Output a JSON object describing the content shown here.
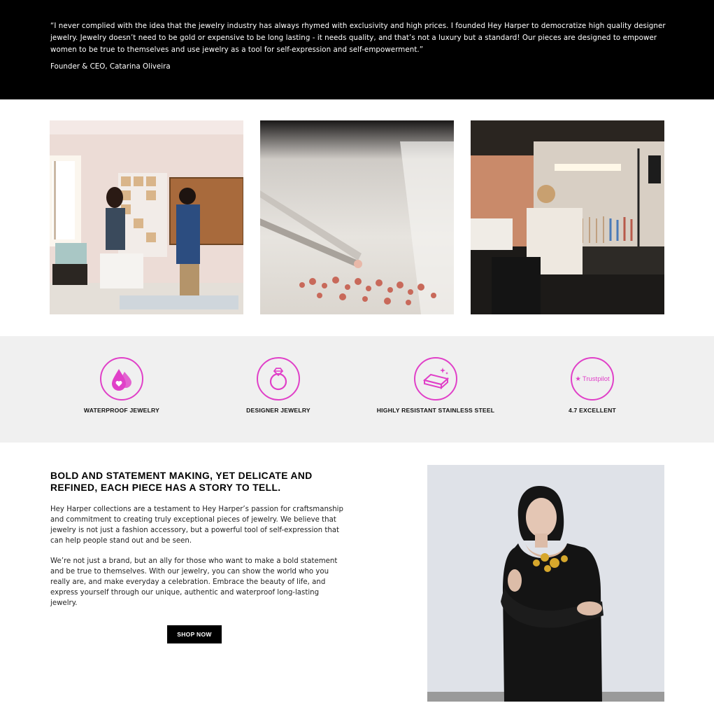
{
  "quote": {
    "text": "“I never complied with the idea that the jewelry industry has always rhymed with exclusivity and high prices. I founded Hey Harper to democratize high quality designer jewelry. Jewelry doesn’t need to be gold or expensive to be long lasting - it needs quality, and that’s not a luxury but a standard! Our pieces are designed to empower women to be true to themselves and use jewelry as a tool for self-expression and self-empowerment.”",
    "author": "Founder & CEO, Catarina Oliveira"
  },
  "features": [
    {
      "label": "WATERPROOF JEWELRY",
      "icon": "waterproof-drop-icon"
    },
    {
      "label": "DESIGNER JEWELRY",
      "icon": "ring-icon"
    },
    {
      "label": "HIGHLY RESISTANT STAINLESS STEEL",
      "icon": "steel-bar-icon"
    },
    {
      "label": "4.7 EXCELLENT",
      "icon": "trustpilot-icon",
      "badge": "Trustpilot"
    }
  ],
  "story": {
    "title": "BOLD AND STATEMENT MAKING, YET DELICATE AND REFINED, EACH PIECE HAS A STORY TO TELL.",
    "paragraph1": "Hey Harper collections are a testament to Hey Harper’s passion for craftsmanship and commitment to creating truly exceptional pieces of jewelry. We believe that jewelry is not just a fashion accessory, but a powerful tool of self-expression that can help people stand out and be seen.",
    "paragraph2": "We’re not just a brand, but an ally for those who want to make a bold statement and be true to themselves. With our jewelry, you can show the world who you really are, and make everyday a celebration. Embrace the beauty of life, and express yourself through our unique, authentic and waterproof long-lasting jewelry.",
    "button": "SHOP NOW"
  },
  "colors": {
    "accent": "#e040c8",
    "dark": "#000000",
    "band": "#f0f0f0"
  }
}
